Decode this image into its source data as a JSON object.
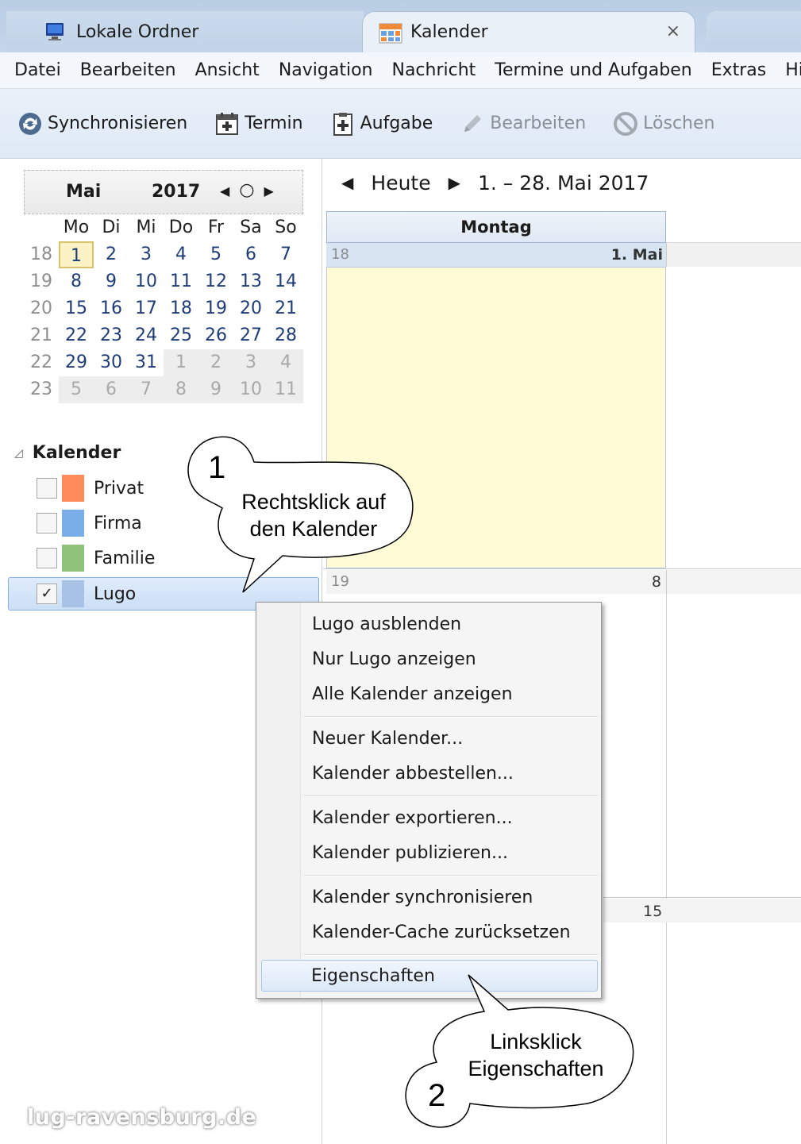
{
  "tabs": [
    {
      "label": "Lokale Ordner",
      "icon": "computer-icon"
    },
    {
      "label": "Kalender",
      "icon": "calendar-grid-icon",
      "close": "×"
    }
  ],
  "menu": [
    "Datei",
    "Bearbeiten",
    "Ansicht",
    "Navigation",
    "Nachricht",
    "Termine und Aufgaben",
    "Extras",
    "Hilfe"
  ],
  "toolbar": {
    "sync": "Synchronisieren",
    "event": "Termin",
    "task": "Aufgabe",
    "edit": "Bearbeiten",
    "delete": "Löschen"
  },
  "minical": {
    "month": "Mai",
    "year": "2017",
    "nav_prev": "◀",
    "nav_today": "○",
    "nav_next": "▶",
    "weekdays": [
      "Mo",
      "Di",
      "Mi",
      "Do",
      "Fr",
      "Sa",
      "So"
    ],
    "weeks": [
      {
        "kw": "18",
        "days": [
          "1",
          "2",
          "3",
          "4",
          "5",
          "6",
          "7"
        ]
      },
      {
        "kw": "19",
        "days": [
          "8",
          "9",
          "10",
          "11",
          "12",
          "13",
          "14"
        ]
      },
      {
        "kw": "20",
        "days": [
          "15",
          "16",
          "17",
          "18",
          "19",
          "20",
          "21"
        ]
      },
      {
        "kw": "21",
        "days": [
          "22",
          "23",
          "24",
          "25",
          "26",
          "27",
          "28"
        ]
      },
      {
        "kw": "22",
        "days": [
          "29",
          "30",
          "31",
          "1",
          "2",
          "3",
          "4"
        ]
      },
      {
        "kw": "23",
        "days": [
          "5",
          "6",
          "7",
          "8",
          "9",
          "10",
          "11"
        ]
      }
    ],
    "selected_day": "1"
  },
  "calendars": {
    "title": "Kalender",
    "items": [
      {
        "name": "Privat",
        "color": "#fd8c5a",
        "checked": false
      },
      {
        "name": "Firma",
        "color": "#7aaee9",
        "checked": false
      },
      {
        "name": "Familie",
        "color": "#8fc27a",
        "checked": false
      },
      {
        "name": "Lugo",
        "color": "#a7c2e4",
        "checked": true
      }
    ],
    "check_mark": "✓"
  },
  "view": {
    "prev": "◀",
    "today": "Heute",
    "next": "▶",
    "range": "1. – 28. Mai 2017",
    "day_header": "Montag",
    "week1_kw": "18",
    "week1_date": "1. Mai",
    "week2_kw": "19",
    "week2_date": "8",
    "week3_date": "15"
  },
  "context_menu": [
    {
      "label": "Lugo ausblenden",
      "group": 1
    },
    {
      "label": "Nur Lugo anzeigen",
      "group": 1
    },
    {
      "label": "Alle Kalender anzeigen",
      "group": 1
    },
    {
      "label": "Neuer Kalender...",
      "group": 2
    },
    {
      "label": "Kalender abbestellen...",
      "group": 2
    },
    {
      "label": "Kalender exportieren...",
      "group": 3
    },
    {
      "label": "Kalender publizieren...",
      "group": 3
    },
    {
      "label": "Kalender synchronisieren",
      "group": 4
    },
    {
      "label": "Kalender-Cache zurücksetzen",
      "group": 4
    },
    {
      "label": "Eigenschaften",
      "group": 5
    }
  ],
  "callouts": {
    "one_num": "1",
    "one_line1": "Rechtsklick auf",
    "one_line2": "den Kalender",
    "two_num": "2",
    "two_line1": "Linksklick",
    "two_line2": "Eigenschaften"
  },
  "watermark": "lug-ravensburg.de"
}
